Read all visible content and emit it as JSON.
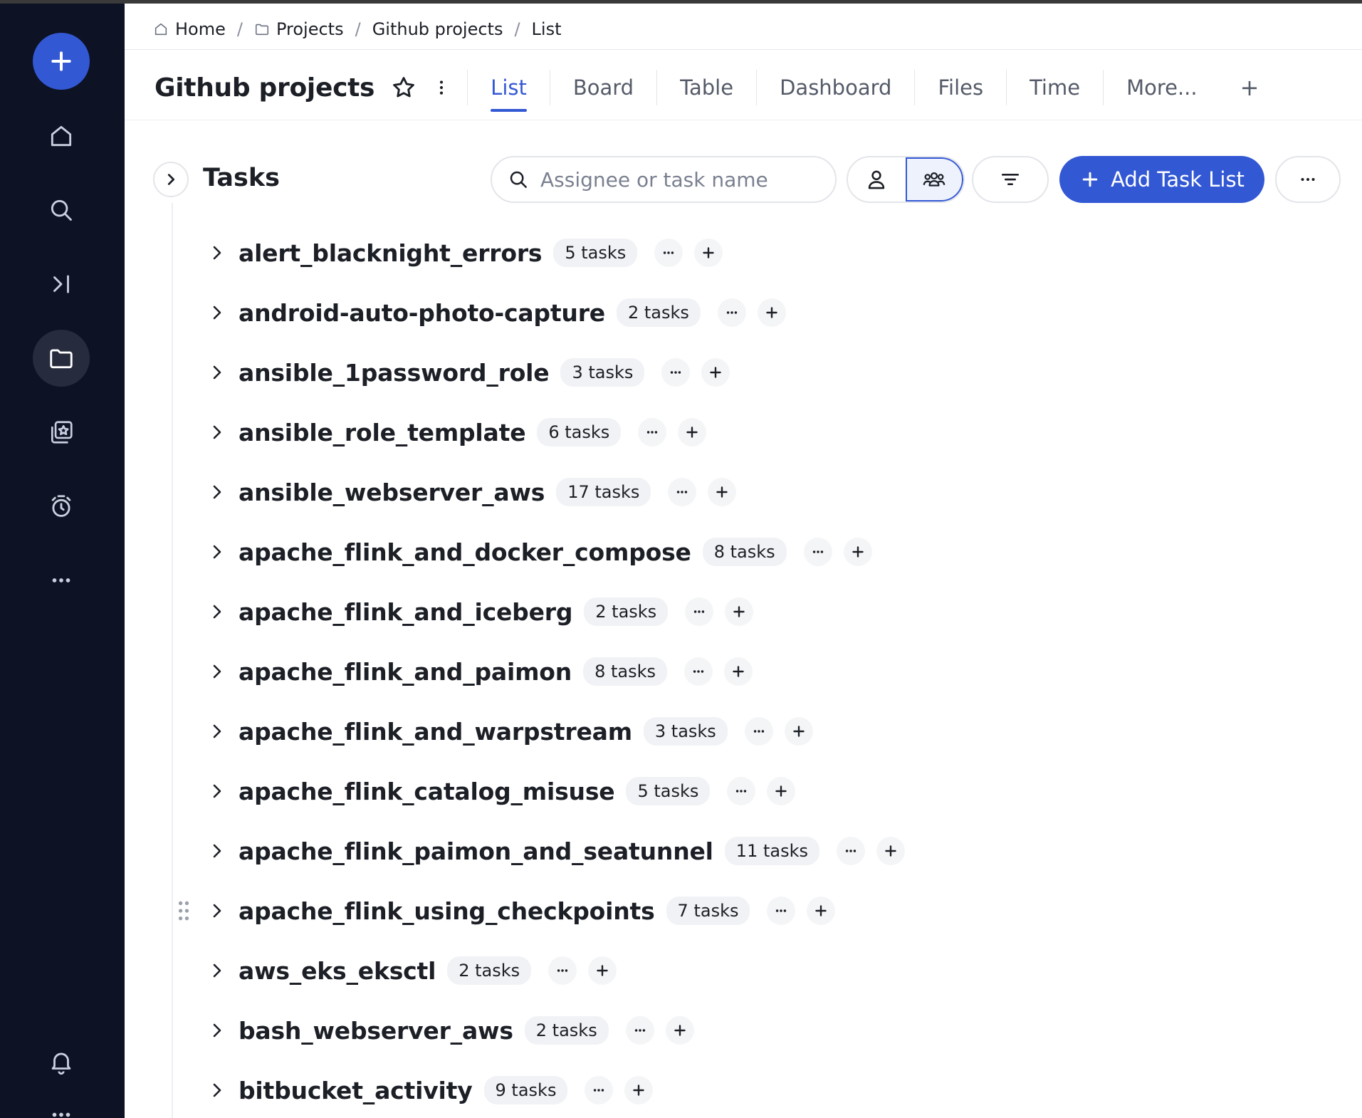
{
  "breadcrumb": [
    {
      "label": "Home",
      "icon": "home-icon"
    },
    {
      "label": "Projects",
      "icon": "folder-icon"
    },
    {
      "label": "Github projects"
    },
    {
      "label": "List"
    }
  ],
  "header": {
    "title": "Github projects",
    "tabs": [
      "List",
      "Board",
      "Table",
      "Dashboard",
      "Files",
      "Time",
      "More..."
    ],
    "active_tab": "List",
    "add_tab_label": "+"
  },
  "tasks": {
    "title": "Tasks",
    "search_placeholder": "Assignee or task name",
    "add_button_label": "Add Task List"
  },
  "task_lists": [
    {
      "name": "alert_blacknight_errors",
      "count": "5 tasks"
    },
    {
      "name": "android-auto-photo-capture",
      "count": "2 tasks"
    },
    {
      "name": "ansible_1password_role",
      "count": "3 tasks"
    },
    {
      "name": "ansible_role_template",
      "count": "6 tasks"
    },
    {
      "name": "ansible_webserver_aws",
      "count": "17 tasks"
    },
    {
      "name": "apache_flink_and_docker_compose",
      "count": "8 tasks"
    },
    {
      "name": "apache_flink_and_iceberg",
      "count": "2 tasks"
    },
    {
      "name": "apache_flink_and_paimon",
      "count": "8 tasks"
    },
    {
      "name": "apache_flink_and_warpstream",
      "count": "3 tasks"
    },
    {
      "name": "apache_flink_catalog_misuse",
      "count": "5 tasks"
    },
    {
      "name": "apache_flink_paimon_and_seatunnel",
      "count": "11 tasks"
    },
    {
      "name": "apache_flink_using_checkpoints",
      "count": "7 tasks"
    },
    {
      "name": "aws_eks_eksctl",
      "count": "2 tasks"
    },
    {
      "name": "bash_webserver_aws",
      "count": "2 tasks"
    },
    {
      "name": "bitbucket_activity",
      "count": "9 tasks"
    }
  ],
  "colors": {
    "accent": "#3358d4",
    "sidebar_bg": "#0d1224"
  }
}
